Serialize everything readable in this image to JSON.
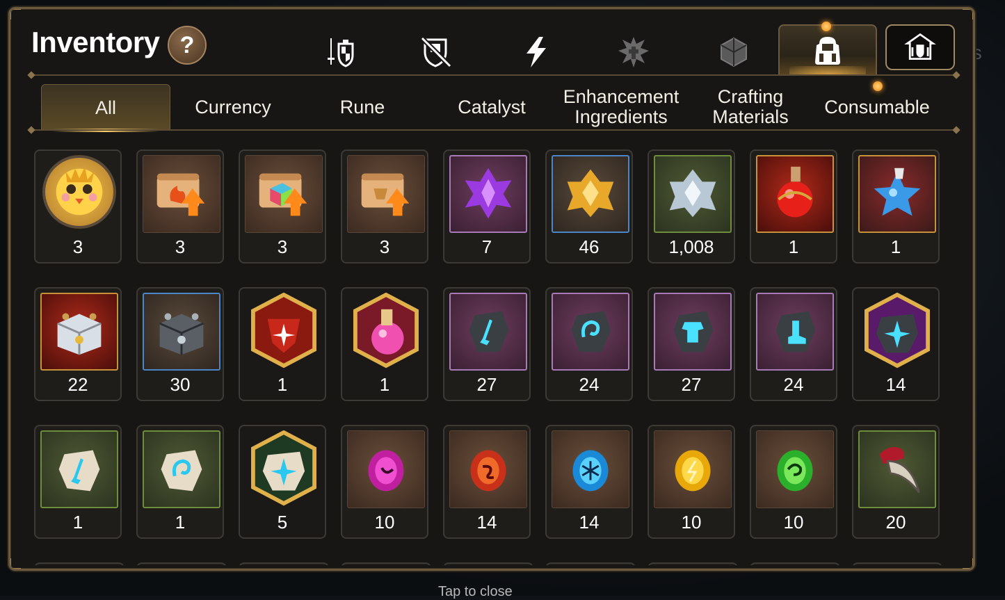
{
  "header": {
    "title": "Inventory",
    "help_label": "?"
  },
  "top_tabs": [
    {
      "icon": "sword-shield-icon",
      "active": false
    },
    {
      "icon": "crossed-shield-icon",
      "active": false
    },
    {
      "icon": "lightning-icon",
      "active": false
    },
    {
      "icon": "artifact-icon",
      "active": false
    },
    {
      "icon": "cube-icon",
      "active": false
    },
    {
      "icon": "backpack-icon",
      "active": true
    },
    {
      "icon": "castle-icon",
      "active": false
    }
  ],
  "category_tabs": [
    {
      "label": "All",
      "active": true
    },
    {
      "label": "Currency",
      "active": false
    },
    {
      "label": "Rune",
      "active": false
    },
    {
      "label": "Catalyst",
      "active": false
    },
    {
      "label": "Enhancement\nIngredients",
      "active": false
    },
    {
      "label": "Crafting\nMaterials",
      "active": false
    },
    {
      "label": "Consumable",
      "active": false
    }
  ],
  "items": [
    {
      "icon": "chick-portrait-icon",
      "count": "3",
      "frame": "circle"
    },
    {
      "icon": "fire-scroll-icon",
      "count": "3",
      "frame": "brown"
    },
    {
      "icon": "rainbow-scroll-icon",
      "count": "3",
      "frame": "brown"
    },
    {
      "icon": "gold-scroll-icon",
      "count": "3",
      "frame": "brown"
    },
    {
      "icon": "purple-crystal-icon",
      "count": "7",
      "frame": "purple"
    },
    {
      "icon": "gold-crystal-icon",
      "count": "46",
      "frame": "blue"
    },
    {
      "icon": "silver-crystal-icon",
      "count": "1,008",
      "frame": "green"
    },
    {
      "icon": "red-potion-icon",
      "count": "1",
      "frame": "red"
    },
    {
      "icon": "blue-star-potion-icon",
      "count": "1",
      "frame": "rainbow"
    },
    {
      "icon": "silver-chest-icon",
      "count": "22",
      "frame": "red"
    },
    {
      "icon": "dark-chest-icon",
      "count": "30",
      "frame": "blue"
    },
    {
      "icon": "red-rune-icon",
      "count": "1",
      "frame": "hexgold"
    },
    {
      "icon": "pink-potion-icon",
      "count": "1",
      "frame": "hexgold"
    },
    {
      "icon": "sword-rune-stone-icon",
      "count": "27",
      "frame": "purple"
    },
    {
      "icon": "swirl-rune-stone-icon",
      "count": "24",
      "frame": "purple"
    },
    {
      "icon": "armor-rune-stone-icon",
      "count": "27",
      "frame": "purple"
    },
    {
      "icon": "boot-rune-stone-icon",
      "count": "24",
      "frame": "purple"
    },
    {
      "icon": "purple-star-rune-icon",
      "count": "14",
      "frame": "hexgold"
    },
    {
      "icon": "sword-pale-rune-icon",
      "count": "1",
      "frame": "green"
    },
    {
      "icon": "swirl-pale-rune-icon",
      "count": "1",
      "frame": "green"
    },
    {
      "icon": "star-pale-rune-icon",
      "count": "5",
      "frame": "hexgold"
    },
    {
      "icon": "magenta-gem-icon",
      "count": "10",
      "frame": "brown"
    },
    {
      "icon": "fire-gem-icon",
      "count": "14",
      "frame": "brown"
    },
    {
      "icon": "ice-gem-icon",
      "count": "14",
      "frame": "brown"
    },
    {
      "icon": "light-gem-icon",
      "count": "10",
      "frame": "brown"
    },
    {
      "icon": "wind-gem-icon",
      "count": "10",
      "frame": "brown"
    },
    {
      "icon": "claw-icon",
      "count": "20",
      "frame": "green"
    }
  ],
  "peek_stripes": [
    "#3a6aa0",
    "#3a6aa0",
    "#3a6aa0",
    "#3a6aa0",
    "#8a6a3a",
    "#8a6a3a",
    "#8a6a3a",
    "#8a7aa0",
    "#3a6aa0"
  ],
  "footer": {
    "tap_close": "Tap to close"
  },
  "colors": {
    "accent_gold": "#c8923a",
    "frame_border": "#6b5a3e",
    "notification": "#f08a10"
  }
}
